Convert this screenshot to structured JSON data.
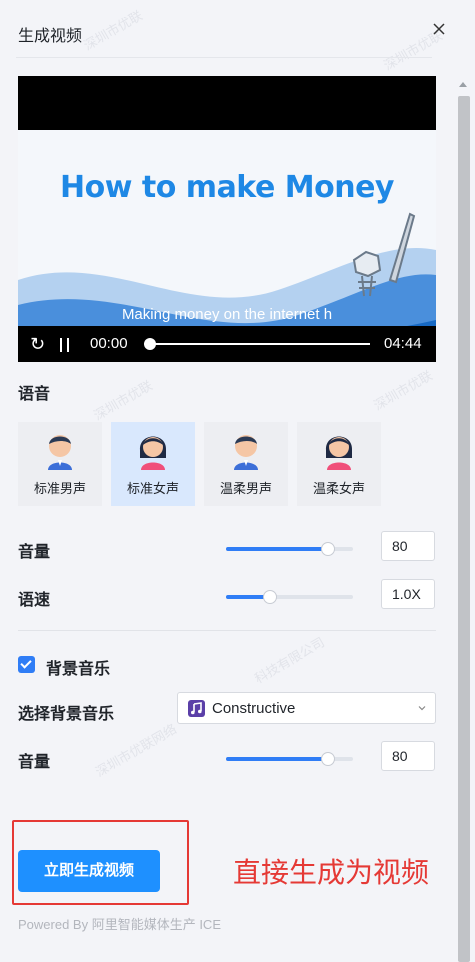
{
  "header": {
    "title": "生成视频",
    "close_icon": "close-icon"
  },
  "video": {
    "title_text": "How to make Money",
    "subtitle": "Making money on the internet h",
    "current_time": "00:00",
    "total_time": "04:44",
    "progress": 0,
    "replay_icon": "replay-icon",
    "pause_icon": "pause-icon"
  },
  "voice_section": {
    "label": "语音",
    "options": [
      {
        "label": "标准男声",
        "icon": "male-avatar-icon",
        "selected": false
      },
      {
        "label": "标准女声",
        "icon": "female-avatar-icon",
        "selected": true
      },
      {
        "label": "温柔男声",
        "icon": "male-avatar-icon",
        "selected": false
      },
      {
        "label": "温柔女声",
        "icon": "female-avatar-icon",
        "selected": false
      }
    ]
  },
  "volume": {
    "label": "音量",
    "value": "80",
    "level": 0.8
  },
  "speed": {
    "label": "语速",
    "value": "1.0X",
    "level": 0.35
  },
  "bg_music": {
    "checkbox_label": "背景音乐",
    "checked": true,
    "select_label": "选择背景音乐",
    "selected_music": "Constructive",
    "volume_label": "音量",
    "volume_value": "80",
    "volume_level": 0.8
  },
  "actions": {
    "generate_label": "立即生成视频",
    "annotation": "直接生成为视频"
  },
  "footer": {
    "powered": "Powered By 阿里智能媒体生产 ICE"
  },
  "colors": {
    "accent": "#2f7df6",
    "button": "#1e90ff",
    "annotation": "#e53935"
  }
}
